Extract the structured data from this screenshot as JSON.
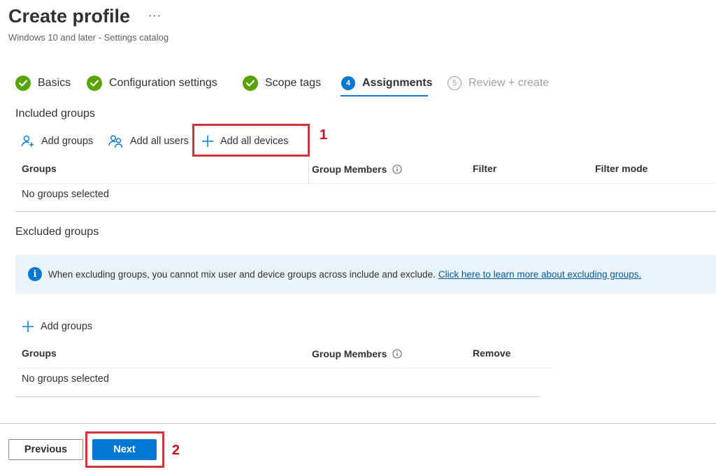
{
  "header": {
    "title": "Create profile",
    "more_label": "···",
    "subtitle": "Windows 10 and later - Settings catalog"
  },
  "steps": [
    {
      "label": "Basics",
      "state": "done"
    },
    {
      "label": "Configuration settings",
      "state": "done"
    },
    {
      "label": "Scope tags",
      "state": "done"
    },
    {
      "label": "Assignments",
      "state": "current",
      "number": "4"
    },
    {
      "label": "Review + create",
      "state": "pending",
      "number": "5"
    }
  ],
  "included": {
    "title": "Included groups",
    "commands": {
      "add_groups": "Add groups",
      "add_all_users": "Add all users",
      "add_all_devices": "Add all devices"
    },
    "columns": {
      "groups": "Groups",
      "group_members": "Group Members",
      "filter": "Filter",
      "filter_mode": "Filter mode"
    },
    "empty_text": "No groups selected"
  },
  "excluded": {
    "title": "Excluded groups",
    "banner_text": "When excluding groups, you cannot mix user and device groups across include and exclude.",
    "banner_link": "Click here to learn more about excluding groups.",
    "add_groups": "Add groups",
    "columns": {
      "groups": "Groups",
      "group_members": "Group Members",
      "remove": "Remove"
    },
    "empty_text": "No groups selected"
  },
  "footer": {
    "previous_label": "Previous",
    "next_label": "Next"
  },
  "annotations": {
    "marker_1": "1",
    "marker_2": "2"
  },
  "colors": {
    "accent": "#0078d4",
    "success": "#57a300",
    "annotation": "#d13438",
    "banner_bg": "#eaf2fa"
  },
  "icons": {
    "step_done": "checkmark-circle-icon",
    "info": "info-icon",
    "add_user": "add-person-icon",
    "add_all_users": "people-icon",
    "add": "plus-icon"
  }
}
